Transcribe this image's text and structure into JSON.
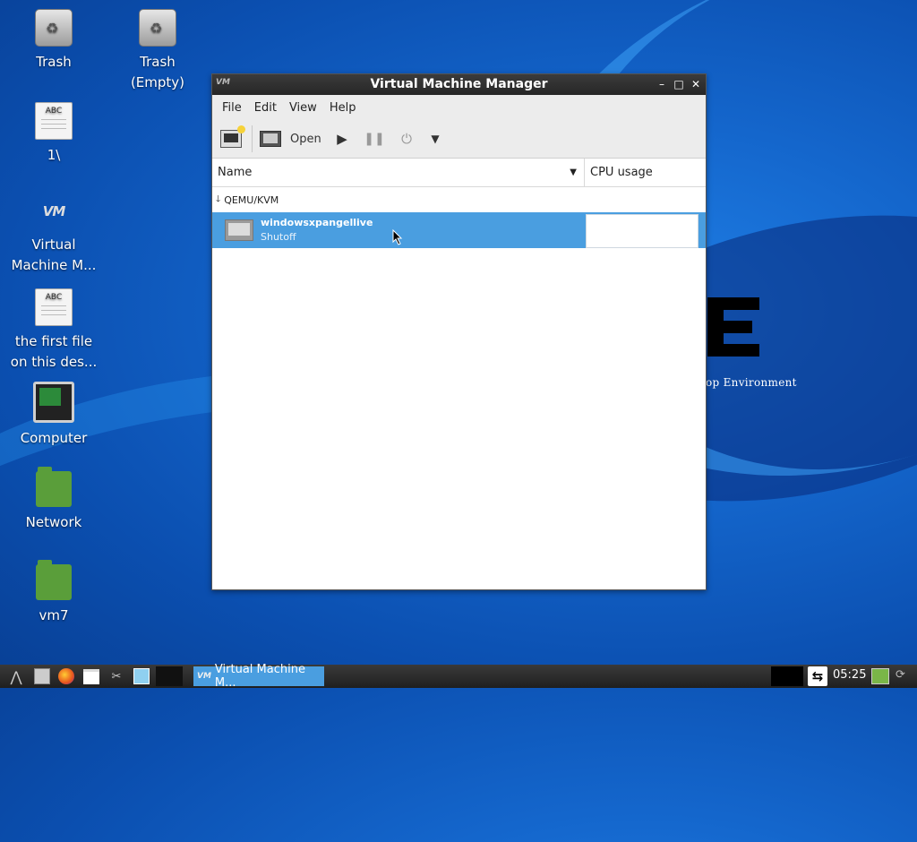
{
  "desktop": {
    "icons": [
      {
        "label": "Trash"
      },
      {
        "label": "Trash (Empty)"
      },
      {
        "label": "1\\"
      },
      {
        "label": "Virtual Machine M..."
      },
      {
        "label": "the first file on this des..."
      },
      {
        "label": "Computer"
      },
      {
        "label": "Network"
      },
      {
        "label": "vm7"
      }
    ],
    "doc_icon_text": "ABC",
    "wallpaper_text": "op Environment"
  },
  "window": {
    "title": "Virtual Machine Manager",
    "controls": {
      "minimize": "–",
      "maximize": "□",
      "close": "✕"
    },
    "menu": [
      "File",
      "Edit",
      "View",
      "Help"
    ],
    "toolbar": {
      "open_label": "Open"
    },
    "columns": {
      "name": "Name",
      "cpu": "CPU usage"
    },
    "group": "QEMU/KVM",
    "vm": {
      "name": "windowsxpangellive",
      "status": "Shutoff"
    }
  },
  "taskbar": {
    "task_label": "Virtual Machine M...",
    "clock": "05:25"
  },
  "colors": {
    "selection": "#4a9ee0",
    "titlebar": "#2e2e2e"
  }
}
